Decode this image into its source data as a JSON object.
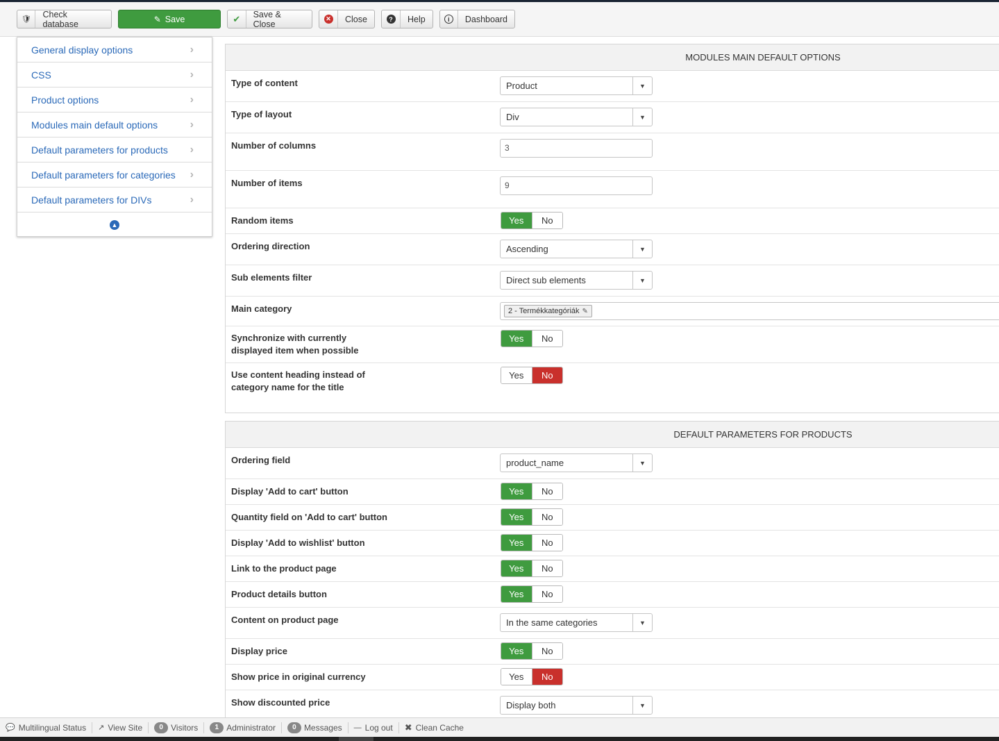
{
  "toolbar": {
    "check_database": "Check database",
    "save": "Save",
    "save_close": "Save & Close",
    "close": "Close",
    "help": "Help",
    "dashboard": "Dashboard",
    "save_color": "#3f9b3f"
  },
  "sidebar": {
    "items": [
      {
        "label": "General display options"
      },
      {
        "label": "CSS"
      },
      {
        "label": "Product options"
      },
      {
        "label": "Modules main default options"
      },
      {
        "label": "Default parameters for products"
      },
      {
        "label": "Default parameters for categories"
      },
      {
        "label": "Default parameters for DIVs"
      }
    ]
  },
  "modules": {
    "title": "MODULES MAIN DEFAULT OPTIONS",
    "type_of_content": {
      "label": "Type of content",
      "value": "Product"
    },
    "type_of_layout": {
      "label": "Type of layout",
      "value": "Div"
    },
    "number_of_columns": {
      "label": "Number of columns",
      "value": "3"
    },
    "number_of_items": {
      "label": "Number of items",
      "value": "9"
    },
    "random_items": {
      "label": "Random items",
      "selected": "Yes"
    },
    "ordering_direction": {
      "label": "Ordering direction",
      "value": "Ascending"
    },
    "sub_elements_filter": {
      "label": "Sub elements filter",
      "value": "Direct sub elements"
    },
    "main_category": {
      "label": "Main category",
      "chip": "2 - Termékkategóriák"
    },
    "synchronize": {
      "label_line1": "Synchronize with currently",
      "label_line2": "displayed item when possible",
      "selected": "Yes"
    },
    "use_heading": {
      "label_line1": "Use content heading instead of",
      "label_line2": "category name for the title",
      "selected": "No"
    }
  },
  "products": {
    "title": "DEFAULT PARAMETERS FOR PRODUCTS",
    "ordering_field": {
      "label": "Ordering field",
      "value": "product_name"
    },
    "add_to_cart": {
      "label": "Display 'Add to cart' button",
      "selected": "Yes"
    },
    "quantity_field": {
      "label": "Quantity field on 'Add to cart' button",
      "selected": "Yes"
    },
    "wishlist": {
      "label": "Display 'Add to wishlist' button",
      "selected": "Yes"
    },
    "link_product": {
      "label": "Link to the product page",
      "selected": "Yes"
    },
    "details_button": {
      "label": "Product details button",
      "selected": "Yes"
    },
    "content_on_page": {
      "label": "Content on product page",
      "value": "In the same categories"
    },
    "display_price": {
      "label": "Display price",
      "selected": "Yes"
    },
    "original_currency": {
      "label": "Show price in original currency",
      "selected": "No"
    },
    "discounted_price": {
      "label": "Show discounted price",
      "value": "Display both"
    }
  },
  "toggle": {
    "yes": "Yes",
    "no": "No"
  },
  "statusbar": {
    "multilingual": "Multilingual Status",
    "view_site": "View Site",
    "visitors_count": "0",
    "visitors": "Visitors",
    "admin_count": "1",
    "administrator": "Administrator",
    "messages_count": "0",
    "messages": "Messages",
    "logout": "Log out",
    "clean_cache": "Clean Cache"
  }
}
